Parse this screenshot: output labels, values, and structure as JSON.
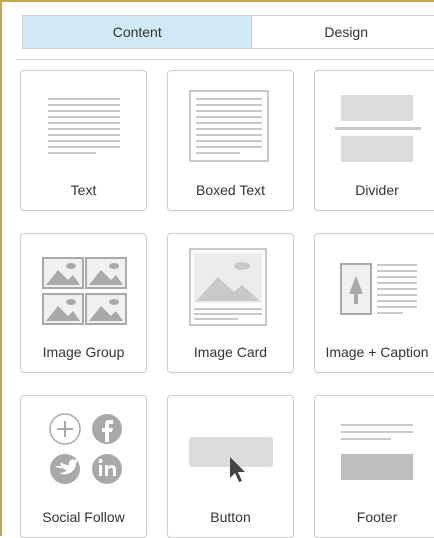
{
  "tabs": [
    {
      "label": "Content",
      "active": true
    },
    {
      "label": "Design",
      "active": false
    }
  ],
  "blocks": [
    {
      "label": "Text",
      "icon": "text-lines-icon"
    },
    {
      "label": "Boxed Text",
      "icon": "boxed-text-icon"
    },
    {
      "label": "Divider",
      "icon": "divider-icon"
    },
    {
      "label": "Image Group",
      "icon": "image-group-icon"
    },
    {
      "label": "Image Card",
      "icon": "image-card-icon"
    },
    {
      "label": "Image + Caption",
      "icon": "image-caption-icon"
    },
    {
      "label": "Social Follow",
      "icon": "social-follow-icon"
    },
    {
      "label": "Button",
      "icon": "button-block-icon"
    },
    {
      "label": "Footer",
      "icon": "footer-icon"
    }
  ],
  "colors": {
    "tab_active_bg": "#cfe9f5",
    "icon_gray": "#c9c9c9",
    "icon_dark": "#a9a9a9",
    "border": "#cfcfcf",
    "frame_accent": "#c8a64a"
  }
}
